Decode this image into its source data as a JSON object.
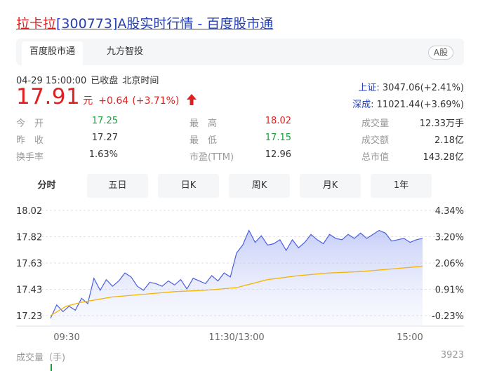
{
  "title": {
    "name": "拉卡拉",
    "code": "[300773]",
    "rest": "A股实时行情 - 百度股市通"
  },
  "tabs": [
    {
      "label": "百度股市通",
      "active": true
    },
    {
      "label": "九方智投",
      "active": false
    }
  ],
  "market_badge": "A股",
  "status": {
    "datetime": "04-29 15:00:00",
    "state": "已收盘",
    "timezone": "北京时间"
  },
  "quote": {
    "price": "17.91",
    "unit": "元",
    "change": "+0.64",
    "change_pct": "(+3.71%)",
    "direction": "up",
    "arrow_icon": "arrow-up-icon"
  },
  "indices": [
    {
      "name": "上证",
      "value": ": 3047.06(+2.41%)"
    },
    {
      "name": "深成",
      "value": ": 11021.44(+3.69%)"
    }
  ],
  "stats": {
    "col1": [
      {
        "label": "今　开",
        "value": "17.25",
        "color": "down"
      },
      {
        "label": "昨　收",
        "value": "17.27",
        "color": "neutral"
      },
      {
        "label": "换手率",
        "value": "1.63%",
        "color": "neutral"
      }
    ],
    "col2": [
      {
        "label": "最　高",
        "value": "18.02",
        "color": "up"
      },
      {
        "label": "最　低",
        "value": "17.15",
        "color": "down"
      },
      {
        "label": "市盈(TTM)",
        "value": "12.96",
        "color": "neutral"
      }
    ],
    "col3": [
      {
        "label": "成交量",
        "value": "12.33万手",
        "color": "neutral"
      },
      {
        "label": "成交额",
        "value": "2.18亿",
        "color": "neutral"
      },
      {
        "label": "总市值",
        "value": "143.28亿",
        "color": "neutral"
      }
    ]
  },
  "period_tabs": [
    {
      "label": "分时",
      "active": true
    },
    {
      "label": "五日",
      "active": false
    },
    {
      "label": "日K",
      "active": false
    },
    {
      "label": "周K",
      "active": false
    },
    {
      "label": "月K",
      "active": false
    },
    {
      "label": "1年",
      "active": false
    }
  ],
  "volume": {
    "label": "成交量（手)",
    "max_label": "3923"
  },
  "colors": {
    "up": "#e02020",
    "down": "#1a9e3a",
    "link": "#2440b3",
    "price_line": "#4a5fe0",
    "avg_line": "#f5b400"
  },
  "chart_data": {
    "type": "line",
    "ylim": [
      17.23,
      18.02
    ],
    "y_tick_labels": [
      "18.02",
      "17.82",
      "17.63",
      "17.43",
      "17.23"
    ],
    "y2_tick_labels": [
      "4.34%",
      "3.20%",
      "2.06%",
      "0.91%",
      "-0.23%"
    ],
    "x_tick_labels": [
      "09:30",
      "11:30/13:00",
      "15:00"
    ],
    "n_minutes": 241,
    "series": [
      {
        "role": "price",
        "x": [
          0,
          4,
          8,
          12,
          16,
          20,
          24,
          28,
          32,
          36,
          40,
          44,
          48,
          52,
          56,
          60,
          64,
          68,
          72,
          76,
          80,
          84,
          88,
          92,
          96,
          100,
          104,
          108,
          112,
          116,
          120,
          124,
          128,
          132,
          136,
          140,
          144,
          148,
          152,
          156,
          160,
          164,
          168,
          172,
          176,
          180,
          184,
          188,
          192,
          196,
          200,
          204,
          208,
          212,
          216,
          220,
          224,
          228,
          232,
          236,
          240
        ],
        "values": [
          17.21,
          17.31,
          17.26,
          17.3,
          17.27,
          17.36,
          17.32,
          17.51,
          17.42,
          17.5,
          17.45,
          17.49,
          17.55,
          17.52,
          17.45,
          17.42,
          17.48,
          17.47,
          17.45,
          17.49,
          17.46,
          17.5,
          17.43,
          17.51,
          17.49,
          17.47,
          17.53,
          17.49,
          17.55,
          17.52,
          17.7,
          17.76,
          17.87,
          17.78,
          17.83,
          17.76,
          17.77,
          17.8,
          17.72,
          17.8,
          17.74,
          17.78,
          17.84,
          17.8,
          17.77,
          17.84,
          17.81,
          17.8,
          17.84,
          17.81,
          17.85,
          17.81,
          17.84,
          17.87,
          17.85,
          17.79,
          17.8,
          17.81,
          17.78,
          17.8,
          17.81
        ]
      },
      {
        "role": "average",
        "x": [
          0,
          10,
          20,
          30,
          40,
          60,
          80,
          100,
          120,
          140,
          160,
          180,
          200,
          220,
          240
        ],
        "values": [
          17.23,
          17.3,
          17.33,
          17.35,
          17.37,
          17.39,
          17.41,
          17.42,
          17.44,
          17.5,
          17.53,
          17.55,
          17.56,
          17.58,
          17.6
        ]
      }
    ]
  }
}
